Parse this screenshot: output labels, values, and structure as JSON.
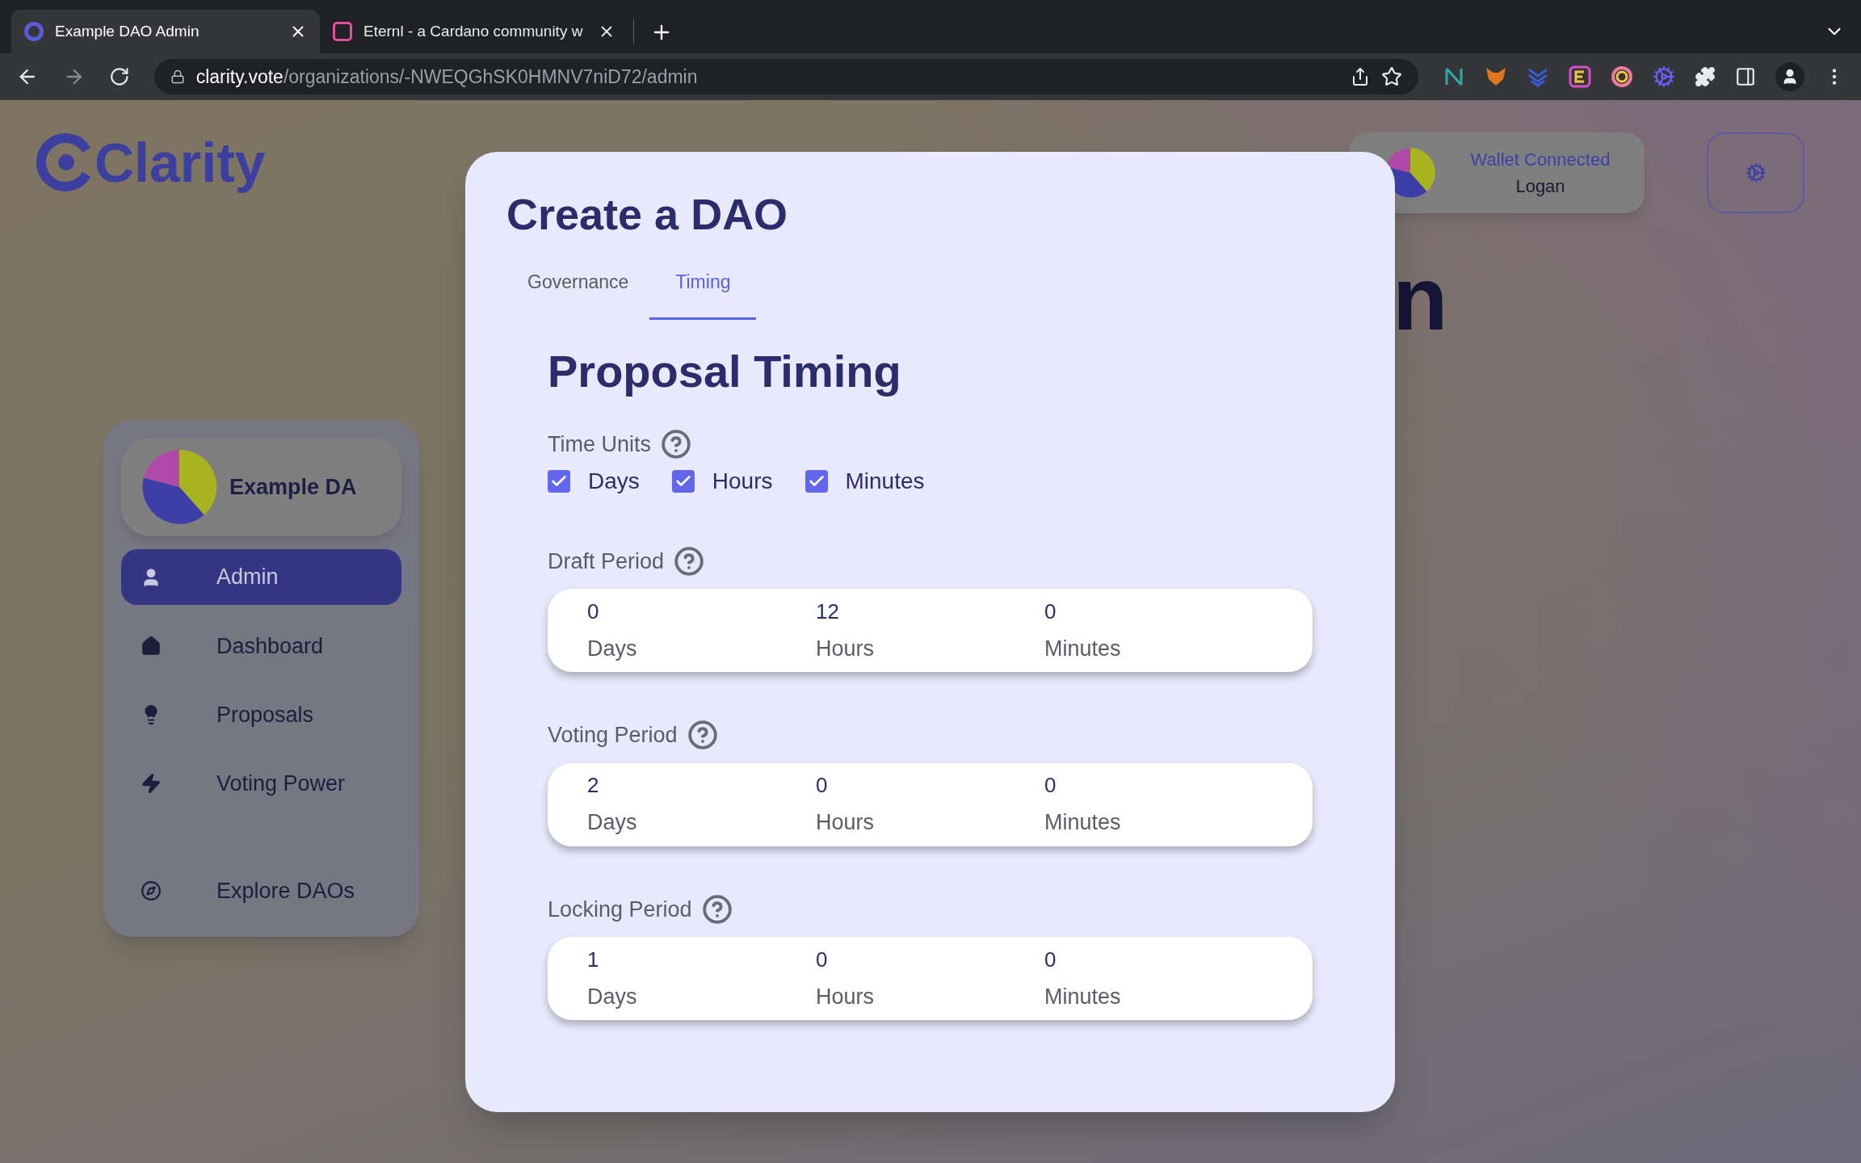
{
  "browser": {
    "tabs": [
      {
        "title": "Example DAO Admin",
        "selected": true
      },
      {
        "title": "Eternl - a Cardano community w",
        "selected": false
      }
    ],
    "url": {
      "host": "clarity.vote",
      "path": "/organizations/-NWEQGhSK0HMNV7niD72/admin"
    }
  },
  "page": {
    "logo": "Clarity",
    "heading_fragment": "n",
    "wallet": {
      "status": "Wallet Connected",
      "name": "Logan"
    },
    "sidebar": {
      "dao_name": "Example DA",
      "items": [
        {
          "label": "Admin",
          "kind": "user",
          "selected": true
        },
        {
          "label": "Dashboard",
          "kind": "home",
          "selected": false
        },
        {
          "label": "Proposals",
          "kind": "bulb",
          "selected": false
        },
        {
          "label": "Voting Power",
          "kind": "bolt",
          "selected": false
        },
        {
          "label": "Explore DAOs",
          "kind": "compass",
          "selected": false
        }
      ]
    }
  },
  "modal": {
    "title": "Create a DAO",
    "tabs": [
      {
        "label": "Governance",
        "selected": false
      },
      {
        "label": "Timing",
        "selected": true
      }
    ],
    "section_title": "Proposal Timing",
    "time_units": {
      "label": "Time Units",
      "options": [
        {
          "label": "Days",
          "checked": true
        },
        {
          "label": "Hours",
          "checked": true
        },
        {
          "label": "Minutes",
          "checked": true
        }
      ]
    },
    "periods": [
      {
        "label": "Draft Period",
        "fields": [
          {
            "value": "0",
            "unit": "Days"
          },
          {
            "value": "12",
            "unit": "Hours"
          },
          {
            "value": "0",
            "unit": "Minutes"
          }
        ]
      },
      {
        "label": "Voting Period",
        "fields": [
          {
            "value": "2",
            "unit": "Days"
          },
          {
            "value": "0",
            "unit": "Hours"
          },
          {
            "value": "0",
            "unit": "Minutes"
          }
        ]
      },
      {
        "label": "Locking Period",
        "fields": [
          {
            "value": "1",
            "unit": "Days"
          },
          {
            "value": "0",
            "unit": "Hours"
          },
          {
            "value": "0",
            "unit": "Minutes"
          }
        ]
      }
    ]
  }
}
